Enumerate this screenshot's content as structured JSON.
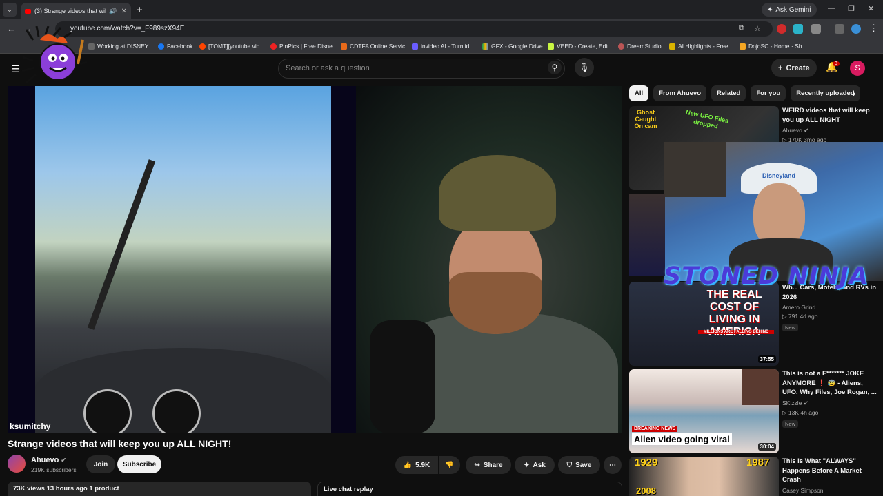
{
  "browser": {
    "tab_title": "(3) Strange videos that will",
    "ask_gemini": "Ask Gemini",
    "url": "youtube.com/watch?v=_F989szX94E",
    "bookmarks": [
      "Working at DISNEY...",
      "Facebook",
      "[TOMT][youtube vid...",
      "PinPics | Free Disne...",
      "CDTFA Online Servic...",
      "invideo AI - Turn id...",
      "GFX - Google Drive",
      "VEED - Create, Edit...",
      "DreamStudio",
      "AI Highlights - Free...",
      "DojoSC - Home · Sh..."
    ]
  },
  "header": {
    "search_placeholder": "Search or ask a question",
    "create_label": "Create",
    "notif_count": "3",
    "avatar_letter": "S"
  },
  "player": {
    "overlay_name": "ksumitchy"
  },
  "video": {
    "title": "Strange videos that will keep you up ALL NIGHT!",
    "channel": "Ahuevo",
    "subscribers": "219K subscribers",
    "join": "Join",
    "subscribe": "Subscribe",
    "likes": "5.9K",
    "share": "Share",
    "ask": "Ask",
    "save": "Save",
    "views_line": "73K views  13 hours ago  1 product",
    "live_chat": "Live chat replay"
  },
  "chips": [
    "All",
    "From Ahuevo",
    "Related",
    "For you",
    "Recently uploaded"
  ],
  "recs": [
    {
      "title": "WEIRD videos that will keep you up ALL NIGHT",
      "channel": "Ahuevo",
      "meta": "▷ 170K  3mo ago",
      "thumb_text1": "Ghost Caught On cam",
      "thumb_text2": "New UFO Files dropped"
    },
    {
      "title": "Wh... Cars, Motels, and RVs in 2026",
      "channel": "Amero Grind",
      "meta": "▷ 791  4d ago",
      "new": "New",
      "duration": "37:55",
      "thumb_text1": "THE REAL COST OF LIVING IN AMERICA",
      "thumb_text2": "MILLIONS ARE FALLING BEHIND"
    },
    {
      "title": "This is not a F******* JOKE ANYMORE ❗ 😰 - Aliens, UFO, Why Files, Joe Rogan, ...",
      "channel": "SKizzle",
      "meta": "▷ 13K  4h ago",
      "new": "New",
      "duration": "30:04",
      "thumb_text1": "BREAKING NEWS",
      "thumb_text2": "Alien video going viral"
    },
    {
      "title": "This Is What \"ALWAYS\" Happens Before A Market Crash",
      "channel": "Casey Simpson",
      "thumb_text1": "1929",
      "thumb_text2": "1987",
      "thumb_text3": "2008"
    }
  ],
  "overlay": {
    "ninja_text": "STONED NINJA",
    "hat_text": "Disneyland"
  },
  "colors": {
    "accent_red": "#ff0000",
    "notif_red": "#cc0000",
    "avatar_pink": "#d81b60",
    "ninja_purple": "#4b3bd8"
  }
}
